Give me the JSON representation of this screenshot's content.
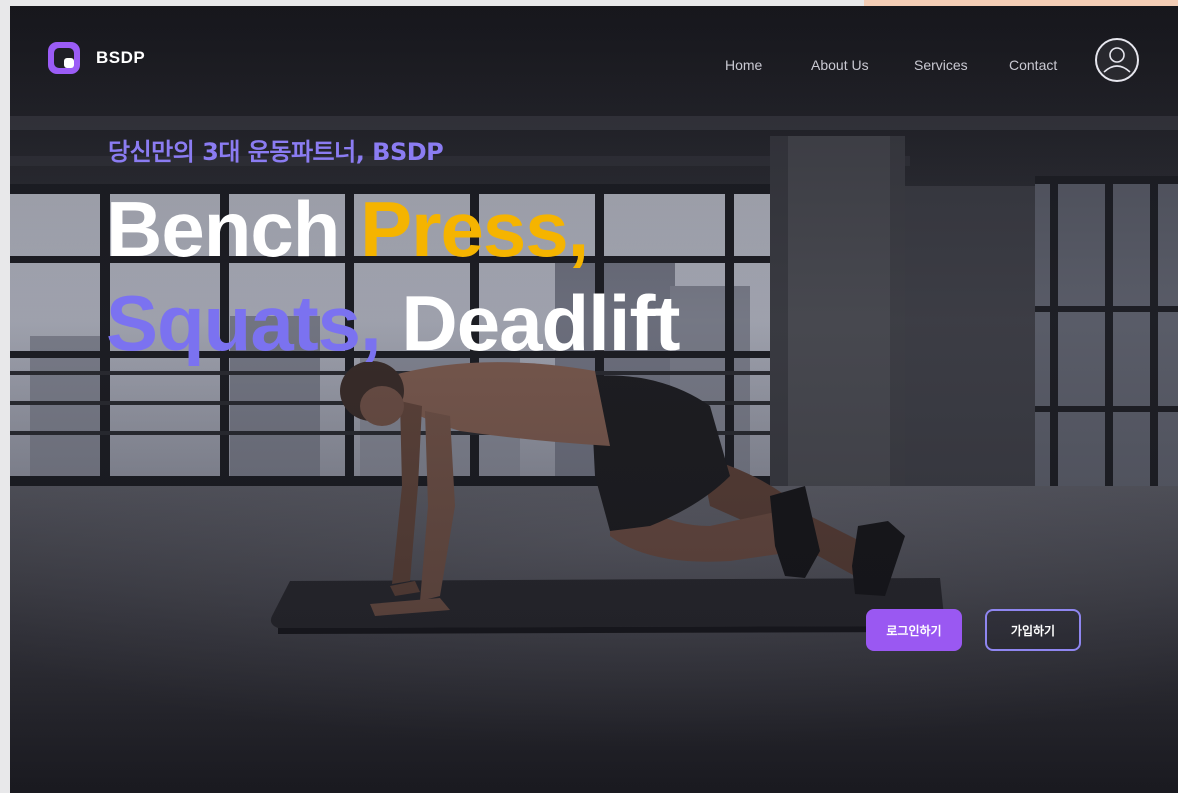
{
  "brand": {
    "name": "BSDP",
    "accent": "#9b5cf6",
    "icon": "logo-mark-icon"
  },
  "nav": {
    "items": [
      {
        "label": "Home"
      },
      {
        "label": "About Us"
      },
      {
        "label": "Services"
      },
      {
        "label": "Contact"
      }
    ],
    "profile_icon": "user-avatar-icon"
  },
  "hero": {
    "subtitle": "당신만의 3대 운동파트너, BSDP",
    "line1": {
      "word1": "Bench",
      "word2": "Press,"
    },
    "line2": {
      "word1": "Squats,",
      "word2": "Deadlift"
    },
    "colors": {
      "white": "#ffffff",
      "yellow": "#f5b400",
      "purple": "#7b72f0",
      "subtitle": "#8b7cf2"
    }
  },
  "actions": {
    "login_label": "로그인하기",
    "signup_label": "가입하기",
    "login_color": "#9a58f2",
    "signup_border": "#8f86f0"
  }
}
